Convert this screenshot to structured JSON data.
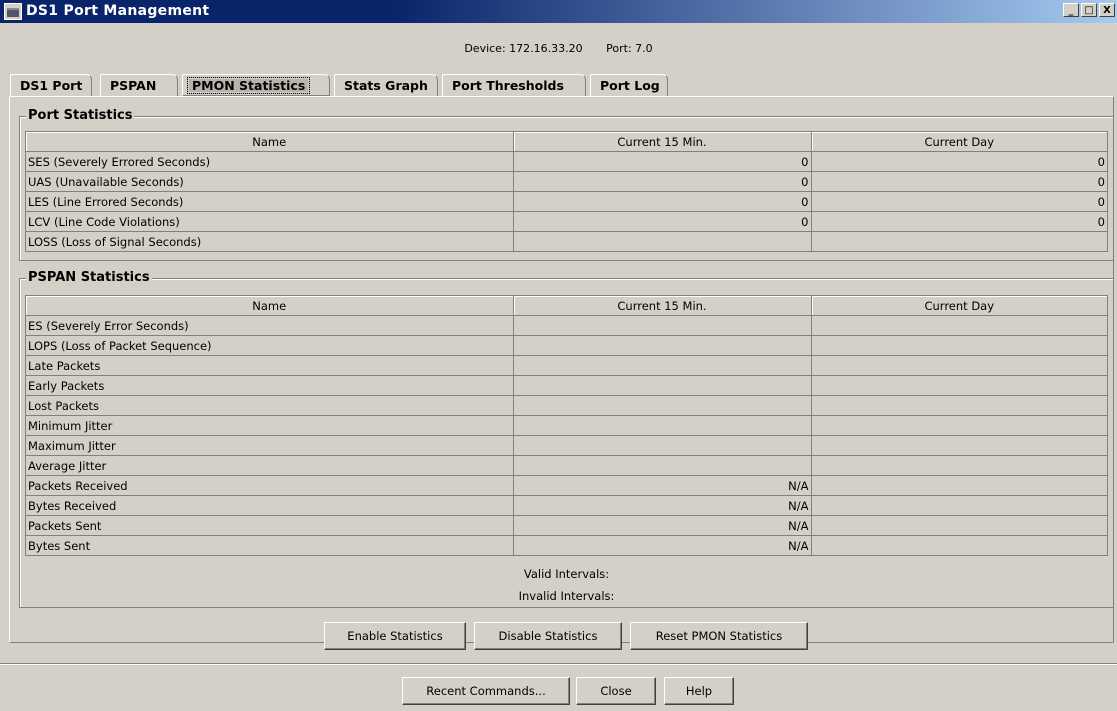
{
  "window": {
    "title": "DS1 Port Management",
    "controls": [
      "_",
      "□",
      "X"
    ]
  },
  "header": {
    "device_label": "Device: 172.16.33.20",
    "port_label": "Port: 7.0"
  },
  "tabs": [
    {
      "label": "DS1 Port",
      "active": false
    },
    {
      "label": "PSPAN",
      "active": false
    },
    {
      "label": "PMON Statistics",
      "active": true
    },
    {
      "label": "Stats Graph",
      "active": false
    },
    {
      "label": "Port Thresholds",
      "active": false
    },
    {
      "label": "Port Log",
      "active": false
    }
  ],
  "port_statistics": {
    "title": "Port Statistics",
    "columns": [
      "Name",
      "Current 15 Min.",
      "Current Day"
    ],
    "rows": [
      [
        "SES (Severely Errored Seconds)",
        "0",
        "0"
      ],
      [
        "UAS (Unavailable Seconds)",
        "0",
        "0"
      ],
      [
        "LES (Line Errored Seconds)",
        "0",
        "0"
      ],
      [
        "LCV (Line Code Violations)",
        "0",
        "0"
      ],
      [
        "LOSS (Loss of Signal Seconds)",
        "",
        ""
      ]
    ]
  },
  "pspan_statistics": {
    "title": "PSPAN Statistics",
    "columns": [
      "Name",
      "Current 15 Min.",
      "Current Day"
    ],
    "rows": [
      [
        "ES (Severely Error Seconds)",
        "",
        ""
      ],
      [
        "LOPS (Loss of Packet Sequence)",
        "",
        ""
      ],
      [
        "Late Packets",
        "",
        ""
      ],
      [
        "Early Packets",
        "",
        ""
      ],
      [
        "Lost Packets",
        "",
        ""
      ],
      [
        "Minimum Jitter",
        "",
        ""
      ],
      [
        "Maximum Jitter",
        "",
        ""
      ],
      [
        "Average Jitter",
        "",
        ""
      ],
      [
        "Packets Received",
        "N/A",
        ""
      ],
      [
        "Bytes Received",
        "N/A",
        ""
      ],
      [
        "Packets Sent",
        "N/A",
        ""
      ],
      [
        "Bytes Sent",
        "N/A",
        ""
      ]
    ],
    "valid_intervals_label": "Valid Intervals:",
    "invalid_intervals_label": "Invalid Intervals:"
  },
  "actions": {
    "enable": "Enable Statistics",
    "disable": "Disable Statistics",
    "reset": "Reset PMON Statistics"
  },
  "footer": {
    "recent": "Recent Commands...",
    "close": "Close",
    "help": "Help"
  }
}
